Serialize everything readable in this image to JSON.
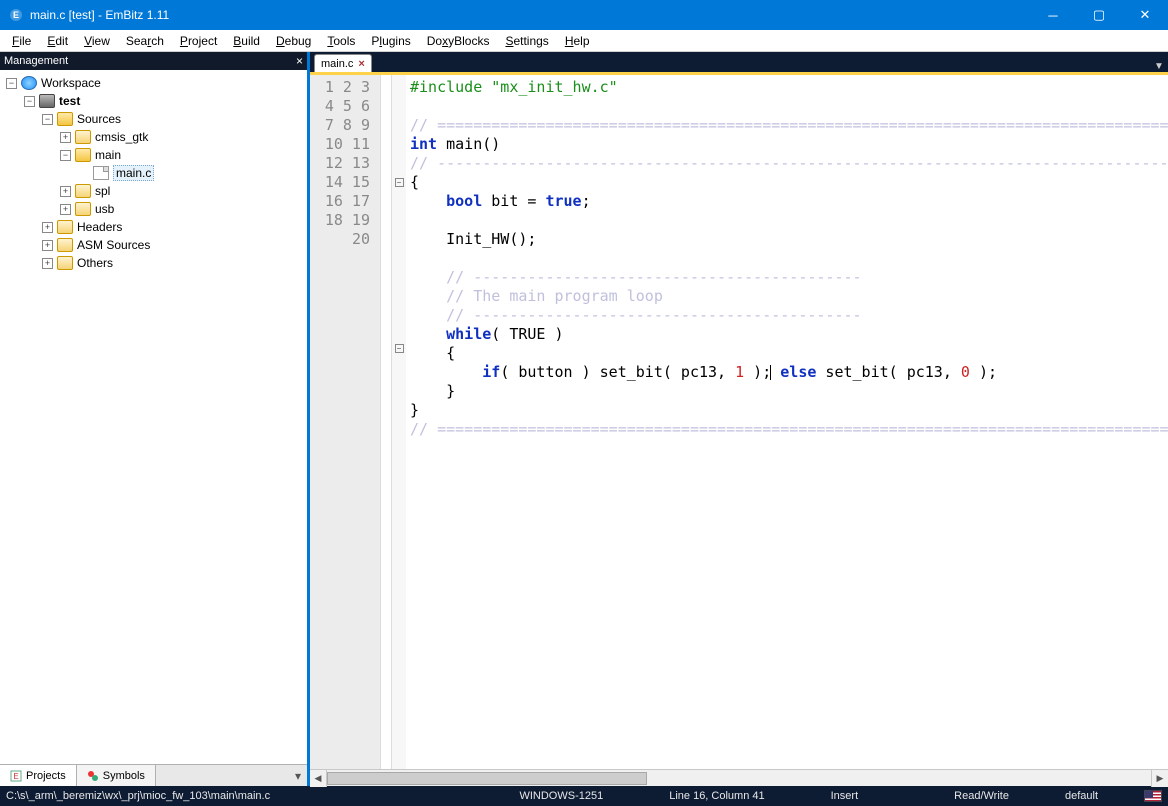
{
  "window": {
    "title": "main.c [test] - EmBitz 1.11"
  },
  "menu": [
    "File",
    "Edit",
    "View",
    "Search",
    "Project",
    "Build",
    "Debug",
    "Tools",
    "Plugins",
    "DoxyBlocks",
    "Settings",
    "Help"
  ],
  "panel": {
    "title": "Management"
  },
  "tree": {
    "workspace": "Workspace",
    "project": "test",
    "sources": "Sources",
    "cmsis": "cmsis_gtk",
    "mainf": "main",
    "mainc": "main.c",
    "spl": "spl",
    "usb": "usb",
    "headers": "Headers",
    "asm": "ASM Sources",
    "others": "Others"
  },
  "sidetabs": {
    "projects": "Projects",
    "symbols": "Symbols"
  },
  "editor": {
    "tab": "main.c"
  },
  "code": {
    "l1a": "#include ",
    "l1b": "\"mx_init_hw.c\"",
    "l3": "// ===================================================================================",
    "l4a": "int",
    "l4b": " main()",
    "l5": "// -----------------------------------------------------------------------------------",
    "l6": "{",
    "l7a": "bool",
    "l7b": " bit = ",
    "l7c": "true",
    "l7d": ";",
    "l9": "Init_HW();",
    "l11": "// -------------------------------------------",
    "l12": "// The main program loop",
    "l13": "// -------------------------------------------",
    "l14a": "while",
    "l14b": "( TRUE )",
    "l15": "{",
    "l16a": "if",
    "l16b": "( button ) set_bit( pc13, ",
    "l16c": "1",
    "l16d": " );",
    "l16e": " else",
    "l16f": " set_bit( pc13, ",
    "l16g": "0",
    "l16h": " );",
    "l17": "}",
    "l18": "}",
    "l19": "// ==================================================================================="
  },
  "status": {
    "path": "C:\\s\\_arm\\_beremiz\\wx\\_prj\\mioc_fw_103\\main\\main.c",
    "encoding": "WINDOWS-1251",
    "pos": "Line 16, Column 41",
    "insert": "Insert",
    "rw": "Read/Write",
    "profile": "default"
  }
}
